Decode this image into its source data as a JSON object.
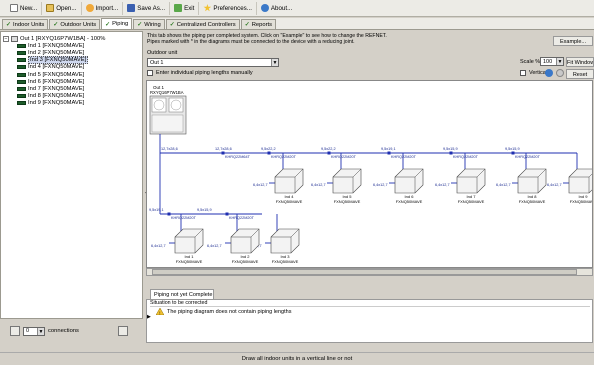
{
  "toolbar": {
    "new": "New...",
    "open": "Open...",
    "import": "Import...",
    "save_as": "Save As...",
    "exit": "Exit",
    "preferences": "Preferences...",
    "about": "About..."
  },
  "tabs": [
    {
      "label": "Indoor Units",
      "checked": true
    },
    {
      "label": "Outdoor Units",
      "checked": true
    },
    {
      "label": "Piping",
      "checked": true,
      "active": true
    },
    {
      "label": "Wiring",
      "checked": true
    },
    {
      "label": "Centralized Controllers",
      "checked": true
    },
    {
      "label": "Reports",
      "checked": true
    }
  ],
  "tree": {
    "root": "Out 1 [RXYQ16P7W1BA] - 100%",
    "items": [
      "Ind 1 [FXNQ50MAVE]",
      "Ind 2 [FXNQ50MAVE]",
      "Ind 3 [FXNQ50MAVE]",
      "Ind 4 [FXNQ50MAVE]",
      "Ind 5 [FXNQ50MAVE]",
      "Ind 6 [FXNQ50MAVE]",
      "Ind 7 [FXNQ50MAVE]",
      "Ind 8 [FXNQ50MAVE]",
      "Ind 9 [FXNQ50MAVE]"
    ],
    "selected_index": 2
  },
  "left_bottom": {
    "connections_value": "0",
    "connections_label": "connections"
  },
  "info": {
    "line1": "This tab shows the piping per completed system. Click on \"Example\" to see how to change the REFNET.",
    "line2": "Pipes marked with * in the diagrams must be connected to the device with a reducing joint.",
    "example_button": "Example..."
  },
  "outdoor": {
    "label": "Outdoor unit",
    "selected": "Out 1"
  },
  "scale": {
    "label": "Scale %",
    "value": "100",
    "fit_button": "Fit Window"
  },
  "options": {
    "manual_lengths": "Enter individual piping lengths manually",
    "vertical": "Vertical",
    "reset_button": "Reset"
  },
  "diagram": {
    "outdoor_name": "Out 1",
    "outdoor_model": "RXYQ16P7W1BA",
    "refnet_label": "KHRQ22M20T",
    "refnet_label_alt": "KHRQ22M64T",
    "refnet_label_alt2": "KHRQ22M29T9",
    "pipe_main": "12,7x28,6",
    "pipe_branch": "9,5x22,2",
    "pipe_branch2": "9,5x19,1",
    "pipe_branch3": "9,5x15,9",
    "pipe_indoor": "6,4x12,7",
    "indoor_model": "FXNQ50MAVE",
    "indoor_units": [
      {
        "name": "Ind 1"
      },
      {
        "name": "Ind 2"
      },
      {
        "name": "Ind 3"
      },
      {
        "name": "Ind 4"
      },
      {
        "name": "Ind 5"
      },
      {
        "name": "Ind 6"
      },
      {
        "name": "Ind 7"
      },
      {
        "name": "Ind 8"
      },
      {
        "name": "Ind 9"
      }
    ],
    "pipe_color": "#1f2fb0"
  },
  "bottom": {
    "tab": "Piping not yet Complete",
    "header": "Situation to be corrected",
    "message": "The piping diagram does not contain piping lengths"
  },
  "status": "Draw all indoor units in a vertical line or not"
}
